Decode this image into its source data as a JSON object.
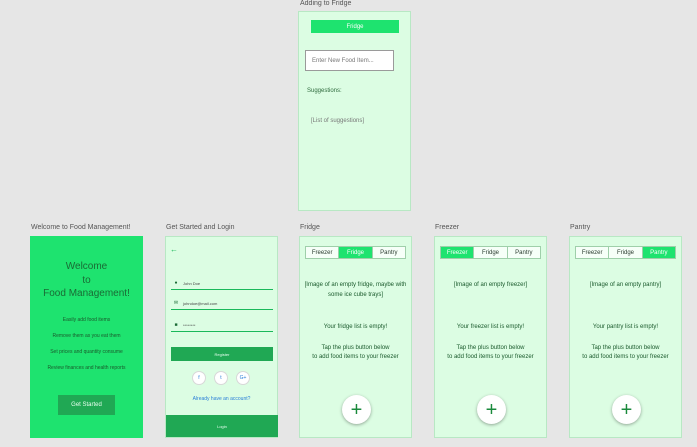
{
  "captions": {
    "adding": "Adding to Fridge",
    "welcome": "Welcome to Food Management!",
    "login": "Get Started and Login",
    "fridge": "Fridge",
    "freezer": "Freezer",
    "pantry": "Pantry"
  },
  "adding": {
    "title": "Fridge",
    "input_placeholder": "Enter New Food Item...",
    "suggestions_label": "Suggestions:",
    "suggestions_list": "[List of suggestions]"
  },
  "welcome": {
    "title": [
      "Welcome",
      "to",
      "Food Management!"
    ],
    "lines": [
      "Easily add food items",
      "Remove them as you eat them",
      "Set prices and quantity consume",
      "Review finances and health reports"
    ],
    "button": "Get Started"
  },
  "login": {
    "back_icon": "arrow-left-icon",
    "name_value": "John Doe",
    "email_value": "johndoe@mail.com",
    "password_value": "********",
    "button": "Register",
    "social": [
      "f",
      "t",
      "G+"
    ],
    "link": "Already have an account?",
    "footer": "Login"
  },
  "tabs": [
    "Freezer",
    "Fridge",
    "Pantry"
  ],
  "fridge": {
    "active_tab": 1,
    "image": "[Image of an empty fridge, maybe with some ice cube trays]",
    "empty": "Your fridge list is empty!",
    "hint": [
      "Tap the plus button below",
      "to add food items to your freezer"
    ]
  },
  "freezer": {
    "active_tab": 0,
    "image": "[Image of an empty freezer]",
    "empty": "Your freezer list is empty!",
    "hint": [
      "Tap the plus button below",
      "to add food items to your freezer"
    ]
  },
  "pantry": {
    "active_tab": 2,
    "image": "[Image of an empty pantry]",
    "empty": "Your pantry list is empty!",
    "hint": [
      "Tap the plus button below",
      "to add food items to your freezer"
    ]
  },
  "fab_label": "+",
  "colors": {
    "accent": "#1ee36f",
    "accent_dark": "#20a854",
    "artboard_bg": "#dcfde3"
  }
}
